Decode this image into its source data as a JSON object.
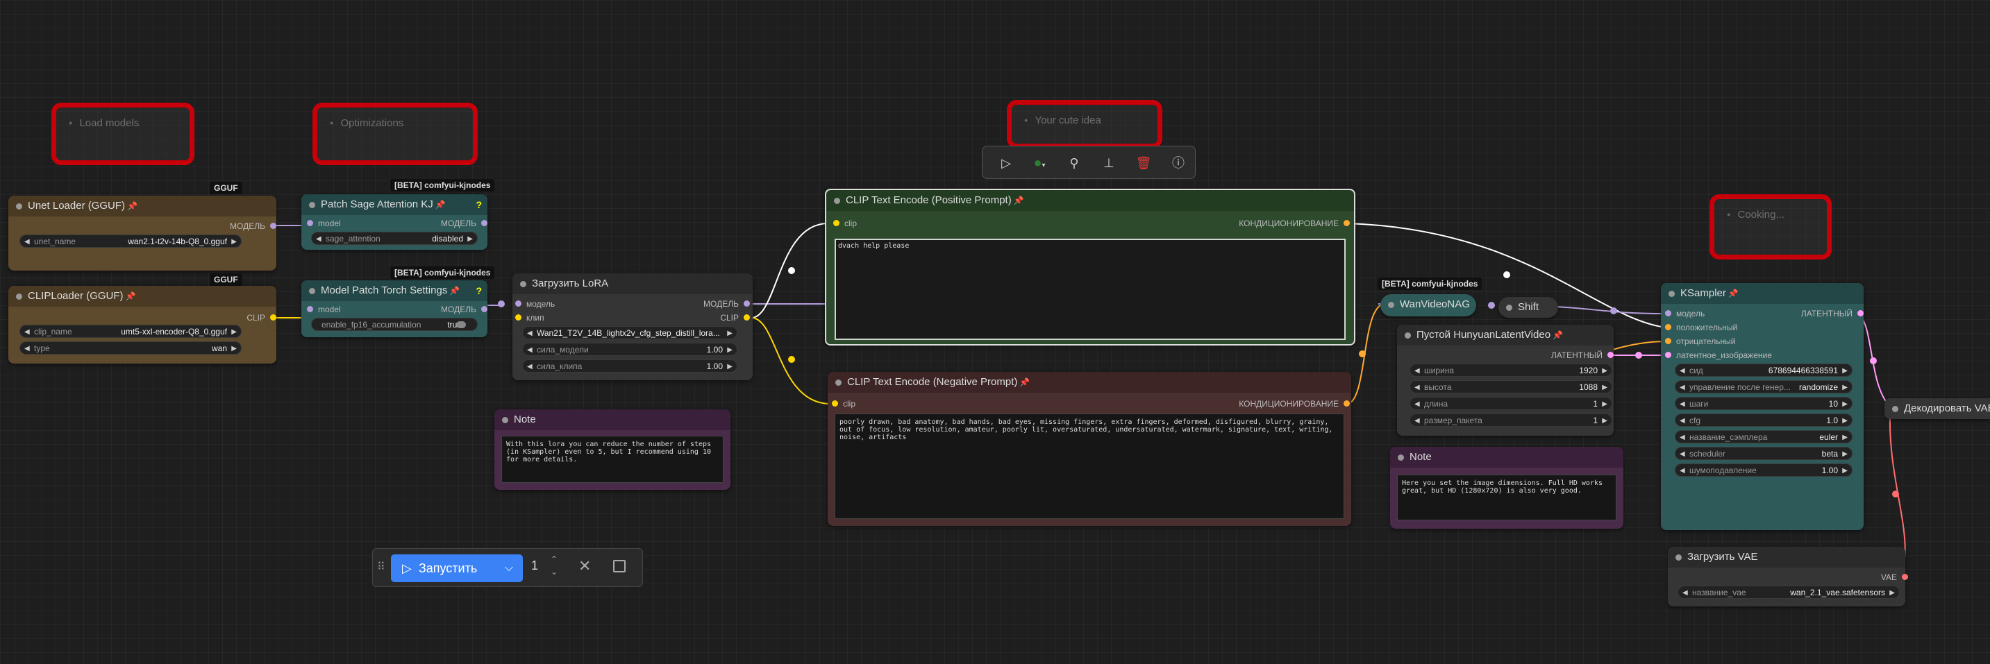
{
  "groups": [
    {
      "title": "Load models"
    },
    {
      "title": "Optimizations"
    },
    {
      "title": "Your cute idea"
    },
    {
      "title": "Cooking..."
    }
  ],
  "badges": {
    "gguf": "GGUF",
    "kjnodes": "[BETA] comfyui-kjnodes"
  },
  "nodes": {
    "unet": {
      "title": "Unet Loader (GGUF)",
      "out": "МОДЕЛЬ",
      "w_label": "unet_name",
      "w_value": "wan2.1-t2v-14b-Q8_0.gguf"
    },
    "clip_loader": {
      "title": "CLIPLoader (GGUF)",
      "out": "CLIP",
      "w1_label": "clip_name",
      "w1_value": "umt5-xxl-encoder-Q8_0.gguf",
      "w2_label": "type",
      "w2_value": "wan"
    },
    "sage": {
      "title": "Patch Sage Attention KJ",
      "in": "model",
      "out": "МОДЕЛЬ",
      "w_label": "sage_attention",
      "w_value": "disabled",
      "help": "?"
    },
    "torch": {
      "title": "Model Patch Torch Settings",
      "in": "model",
      "out": "МОДЕЛЬ",
      "w_label": "enable_fp16_accumulation",
      "w_value": "true",
      "help": "?"
    },
    "lora": {
      "title": "Загрузить LoRA",
      "in1": "модель",
      "in2": "клип",
      "out1": "МОДЕЛЬ",
      "out2": "CLIP",
      "w1_value": "Wan21_T2V_14B_lightx2v_cfg_step_distill_lora...",
      "w2_label": "сила_модели",
      "w2_value": "1.00",
      "w3_label": "сила_клипа",
      "w3_value": "1.00"
    },
    "pos": {
      "title": "CLIP Text Encode (Positive Prompt)",
      "in": "clip",
      "out": "КОНДИЦИОНИРОВАНИЕ",
      "text": "dvach help please"
    },
    "neg": {
      "title": "CLIP Text Encode (Negative Prompt)",
      "in": "clip",
      "out": "КОНДИЦИОНИРОВАНИЕ",
      "text": "poorly drawn, bad anatomy, bad hands, bad eyes, missing fingers, extra fingers, deformed, disfigured, blurry, grainy, out of focus, low resolution, amateur, poorly lit, oversaturated, undersaturated, watermark, signature, text, writing, noise, artifacts"
    },
    "note1": {
      "title": "Note",
      "text": "With this lora you can reduce the number of steps (in KSampler) even to 5, but I recommend using 10 for more details."
    },
    "note2": {
      "title": "Note",
      "text": "Here you set the image dimensions. Full HD works great, but HD (1280x720) is also very good."
    },
    "nag": {
      "title": "WanVideoNAG"
    },
    "shift": {
      "title": "Shift"
    },
    "latent": {
      "title": "Пустой HunyuanLatentVideo",
      "out": "ЛАТЕНТНЫЙ",
      "rows": [
        {
          "label": "ширина",
          "value": "1920"
        },
        {
          "label": "высота",
          "value": "1088"
        },
        {
          "label": "длина",
          "value": "1"
        },
        {
          "label": "размер_пакета",
          "value": "1"
        }
      ]
    },
    "ksampler": {
      "title": "KSampler",
      "in1": "модель",
      "in2": "положительный",
      "in3": "отрицательный",
      "in4": "латентное_изображение",
      "out": "ЛАТЕНТНЫЙ",
      "rows": [
        {
          "label": "сид",
          "value": "678694466338591"
        },
        {
          "label": "управление после генер...",
          "value": "randomize"
        },
        {
          "label": "шаги",
          "value": "10"
        },
        {
          "label": "cfg",
          "value": "1.0"
        },
        {
          "label": "название_сэмплера",
          "value": "euler"
        },
        {
          "label": "scheduler",
          "value": "beta"
        },
        {
          "label": "шумоподавление",
          "value": "1.00"
        }
      ]
    },
    "vae": {
      "title": "Загрузить VAE",
      "out": "VAE",
      "w_label": "название_vae",
      "w_value": "wan_2.1_vae.safetensors"
    },
    "decode": {
      "title": "Декодировать VAE"
    }
  },
  "runbar": {
    "label": "Запустить",
    "count": "1"
  },
  "colors": {
    "model": "#b39ddb",
    "clip": "#ffd500",
    "cond": "#ffa931",
    "latent": "#ff9cf9",
    "vae": "#ff6e6e",
    "group_border": "#c8000a"
  }
}
